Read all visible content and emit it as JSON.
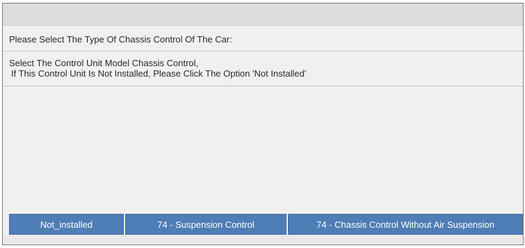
{
  "dialog": {
    "prompt": "Please Select The Type Of Chassis Control Of The Car:",
    "instruction_line1": "Select The Control Unit Model Chassis Control,",
    "instruction_line2": "If This Control Unit Is Not Installed, Please Click The Option 'Not Installed'"
  },
  "options": [
    {
      "label": "Not_installed"
    },
    {
      "label": "74 - Suspension Control"
    },
    {
      "label": "74 - Chassis Control Without Air Suspension"
    }
  ]
}
